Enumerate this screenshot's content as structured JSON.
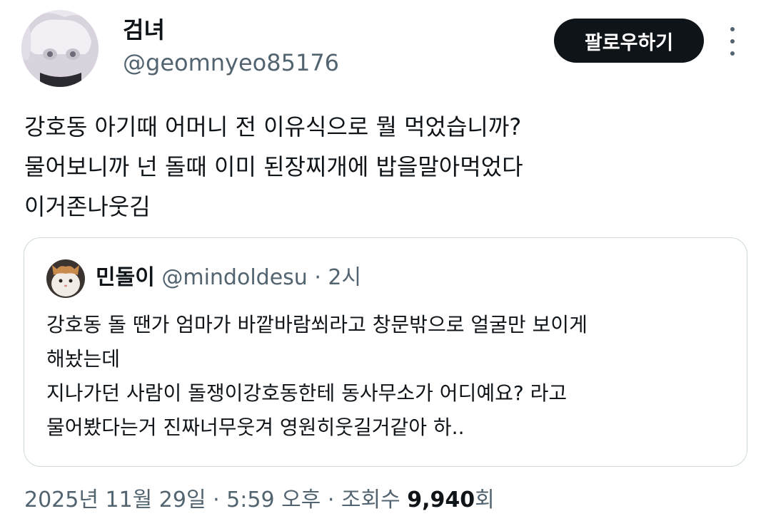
{
  "author": {
    "name": "검녀",
    "handle": "@geomnyeo85176",
    "follow_label": "팔로우하기"
  },
  "tweet": {
    "lines": [
      "강호동 아기때 어머니 전 이유식으로 뭘 먹었습니까?",
      "물어보니까 넌 돌때 이미 된장찌개에 밥을말아먹었다",
      "이거존나웃김"
    ]
  },
  "quote": {
    "name": "민돌이",
    "handle": "@mindoldesu",
    "time": "· 2시",
    "lines": [
      "강호동 돌 땐가 엄마가 바깥바람쐬라고 창문밖으로 얼굴만 보이게",
      "해놨는데",
      "지나가던 사람이 돌쟁이강호동한테 동사무소가 어디예요? 라고",
      "물어봤다는거 진짜너무웃겨 영원히웃길거같아  하.."
    ]
  },
  "footer": {
    "datetime": "2025년 11월 29일 · 5:59 오후 · 조회수 ",
    "views": "9,940",
    "views_suffix": "회"
  }
}
